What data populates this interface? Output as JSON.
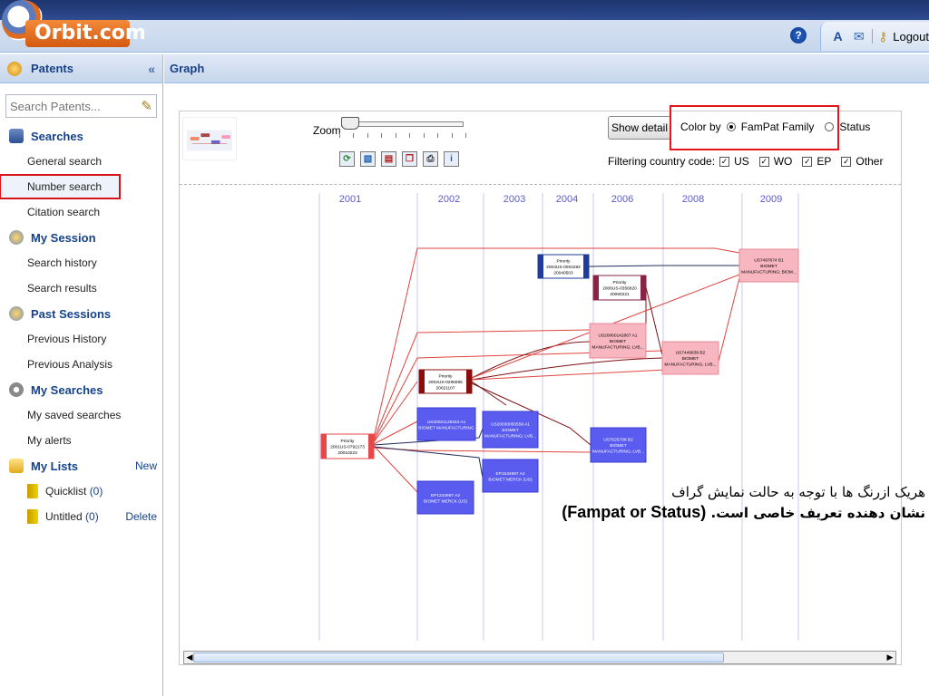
{
  "app": {
    "brand": "Orbit.com",
    "logout_label": "Logout"
  },
  "sidebar": {
    "title": "Patents",
    "collapse_icon": "double-chevron-left-icon",
    "search_placeholder": "Search Patents...",
    "sections": [
      {
        "label": "Searches",
        "items": [
          "General search",
          "Number search",
          "Citation search"
        ]
      },
      {
        "label": "My Session",
        "items": [
          "Search history",
          "Search results"
        ]
      },
      {
        "label": "Past Sessions",
        "items": [
          "Previous History",
          "Previous Analysis"
        ]
      },
      {
        "label": "My Searches",
        "items": [
          "My saved searches",
          "My alerts"
        ]
      },
      {
        "label": "My Lists",
        "action": "New",
        "lists": [
          {
            "label": "Quicklist",
            "count": "(0)"
          },
          {
            "label": "Untitled",
            "count": "(0)",
            "action": "Delete"
          }
        ]
      }
    ],
    "selected_item": "Number search"
  },
  "main": {
    "title": "Graph"
  },
  "controls": {
    "zoom_label": "Zoom",
    "show_detail_label": "Show detail",
    "color_by_label": "Color by",
    "color_by_options": [
      "FamPat Family",
      "Status"
    ],
    "color_by_selected": "FamPat Family",
    "filter_label": "Filtering country code:",
    "filter_options": [
      {
        "label": "US",
        "checked": true
      },
      {
        "label": "WO",
        "checked": true
      },
      {
        "label": "EP",
        "checked": true
      },
      {
        "label": "Other",
        "checked": true
      }
    ]
  },
  "graph": {
    "years": [
      "2001",
      "2002",
      "2003",
      "2004",
      "2006",
      "2008",
      "2009"
    ],
    "nodes": [
      {
        "id": "n1",
        "lines": [
          "Priority",
          "2004US-0004282",
          "20040503"
        ],
        "style": "priority-blue"
      },
      {
        "id": "n2",
        "lines": [
          "US7497874 B1",
          "BIOMET",
          "MANUFACTURING; BIOM..."
        ],
        "style": "pink"
      },
      {
        "id": "n3",
        "lines": [
          "Priority",
          "2006US-0356820",
          "20060221"
        ],
        "style": "priority-maroon"
      },
      {
        "id": "n4",
        "lines": [
          "US20060142867 A1",
          "BIOMET",
          "MANUFACTURING; LVB..."
        ],
        "style": "pink"
      },
      {
        "id": "n5",
        "lines": [
          "US7449839 B2",
          "BIOMET",
          "MANUFACTURING; LVB..."
        ],
        "style": "pink"
      },
      {
        "id": "n6",
        "lines": [
          "Priority",
          "2002US-0295595",
          "20021107"
        ],
        "style": "priority-darkred"
      },
      {
        "id": "n7",
        "lines": [
          "US20021128343 A1",
          "BIOMET MANUFACTURING"
        ],
        "style": "blue"
      },
      {
        "id": "n8",
        "lines": [
          "US20030050558 A1",
          "BIOMET",
          "MANUFACTURING; LVB..."
        ],
        "style": "blue"
      },
      {
        "id": "n9",
        "lines": [
          "US7025788 B2",
          "BIOMET",
          "MANUFACTURING; LVB..."
        ],
        "style": "blue"
      },
      {
        "id": "n10",
        "lines": [
          "Priority",
          "2001US-0792173",
          "20010223"
        ],
        "style": "priority-red"
      },
      {
        "id": "n11",
        "lines": [
          "EP1534997 A2",
          "BIOMET MERCK (US)"
        ],
        "style": "blue"
      },
      {
        "id": "n12",
        "lines": [
          "EP1234997 A2",
          "BIOMET MERCK (US)"
        ],
        "style": "blue"
      }
    ]
  },
  "annotation": {
    "line1": "هریک ازرنگ ها با توجه به حالت نمایش گراف",
    "line2_bold": "(Fampat or Status)",
    "line2_rest": "نشان دهنده تعریف خاصی است."
  },
  "colors": {
    "highlight_red": "#e2161c",
    "header_blue": "#15428b",
    "node_pink": "#f7b6c0",
    "node_blue": "#5a5cf0",
    "priority_red": "#e8474a",
    "priority_darkred": "#8b0e0e",
    "priority_maroon": "#8a2346",
    "priority_blue": "#1f3c9a"
  }
}
